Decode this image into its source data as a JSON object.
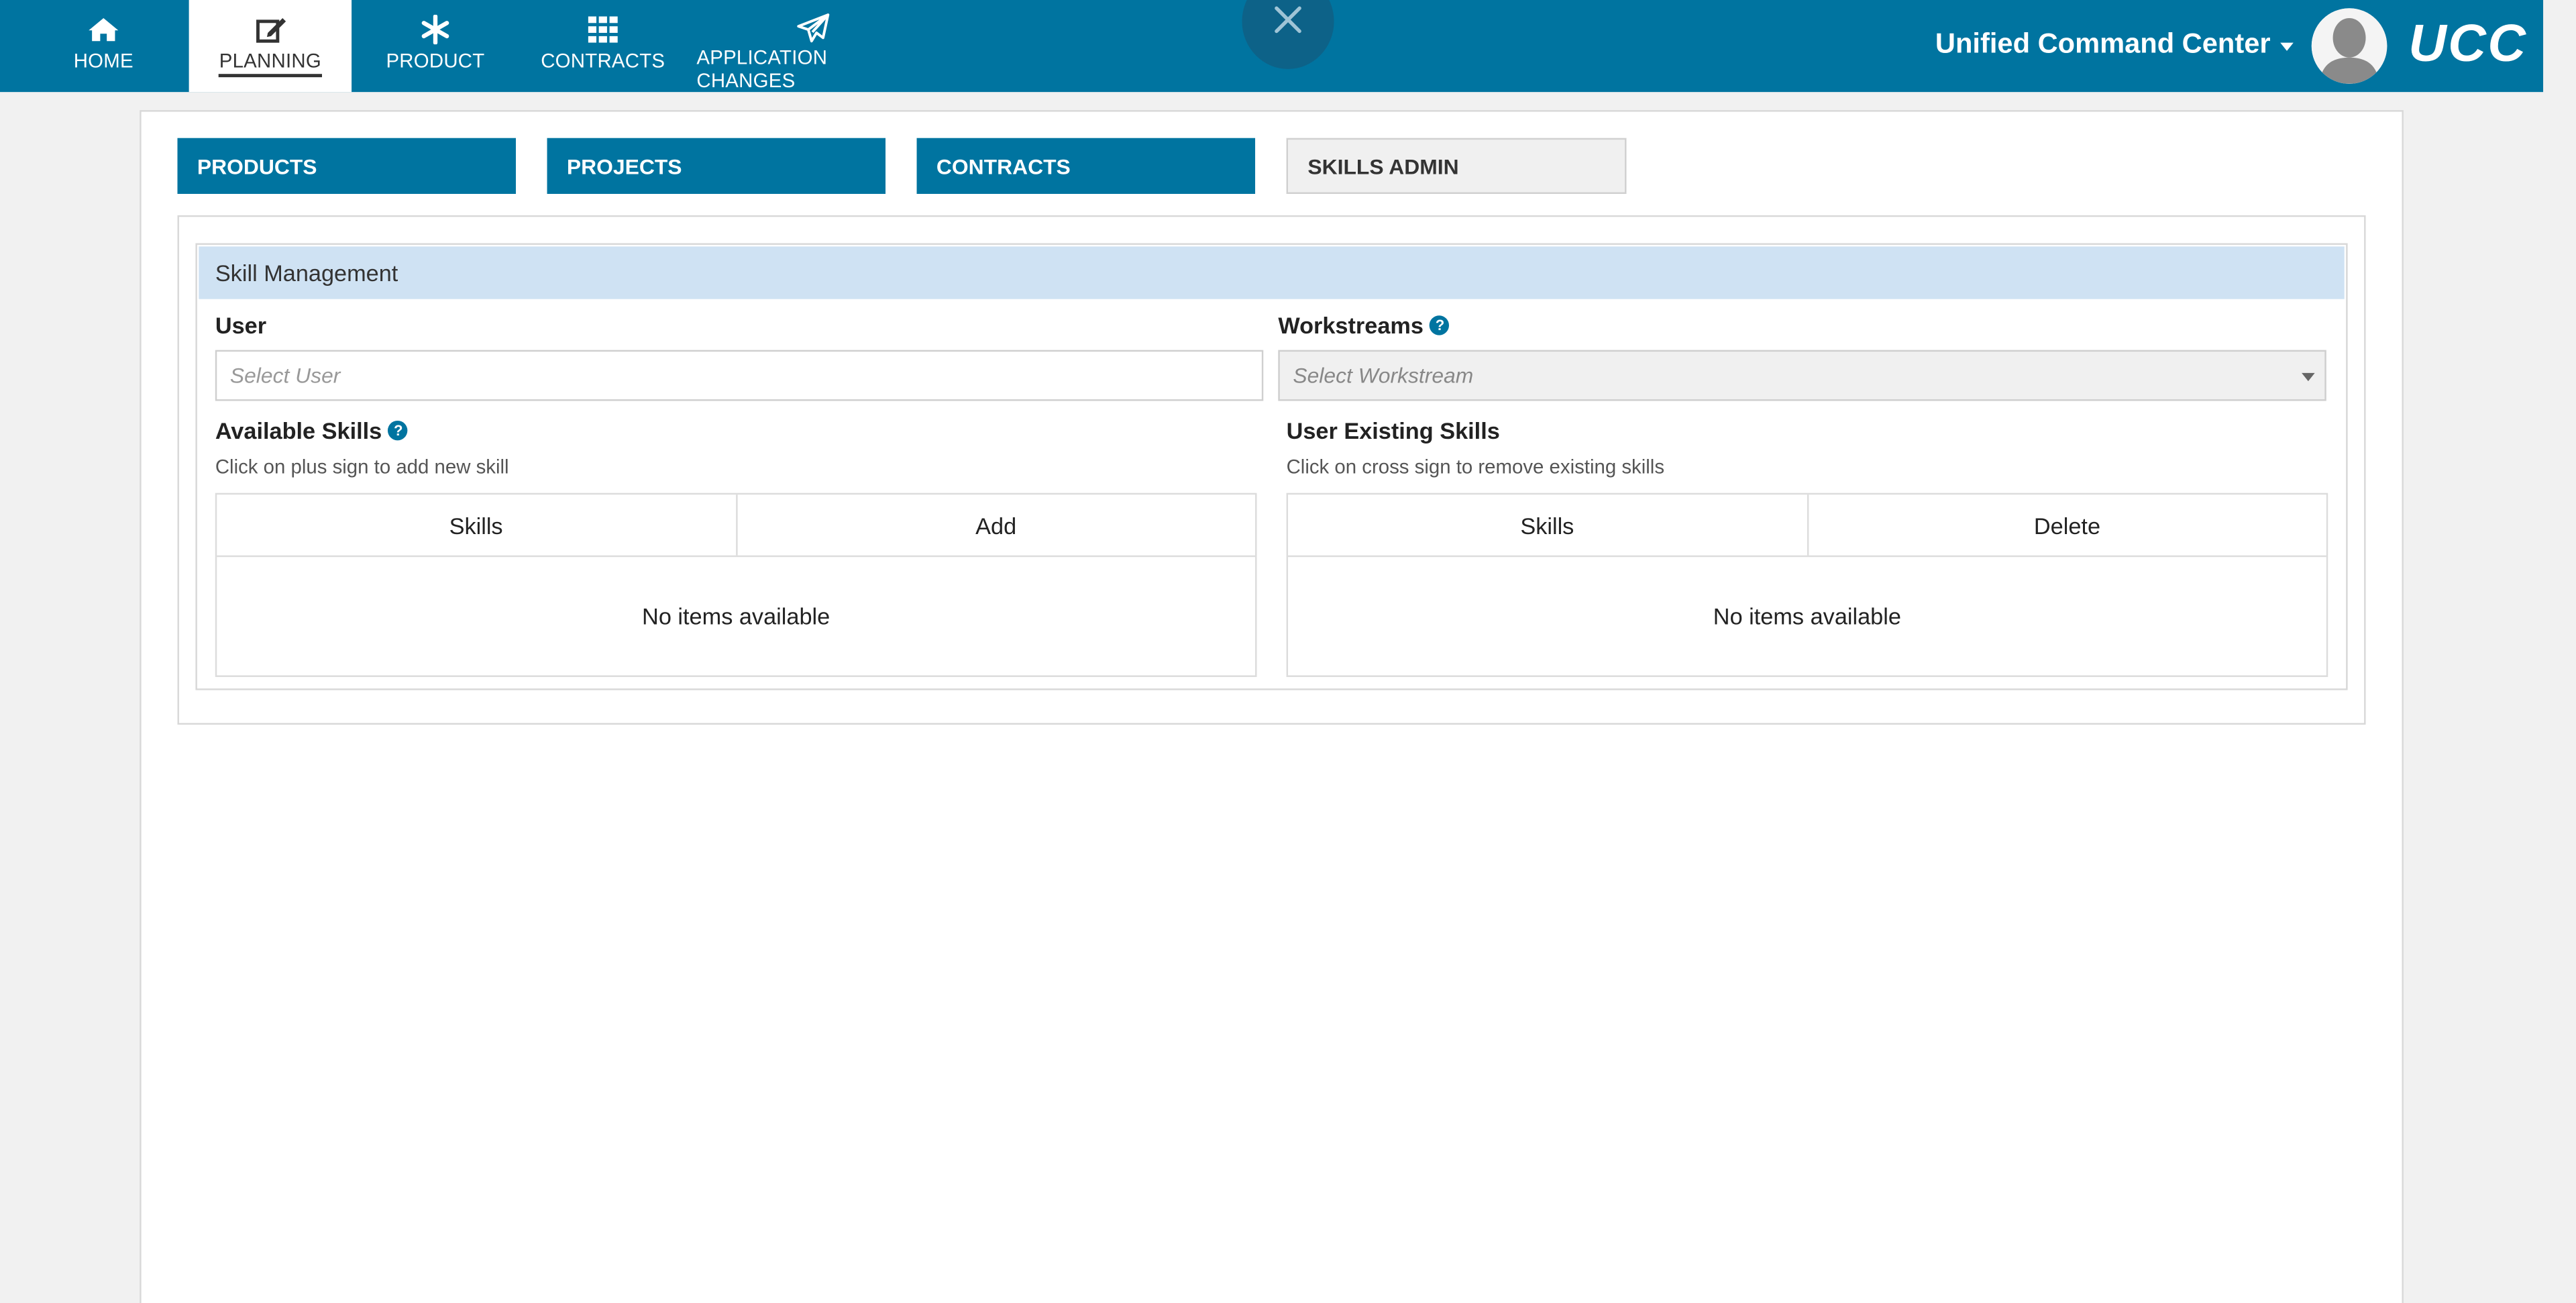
{
  "nav": {
    "items": [
      {
        "label": "HOME",
        "icon": "home-icon"
      },
      {
        "label": "PLANNING",
        "icon": "edit-icon"
      },
      {
        "label": "PRODUCT",
        "icon": "asterisk-icon"
      },
      {
        "label": "CONTRACTS",
        "icon": "grid-icon"
      },
      {
        "label": "APPLICATION CHANGES",
        "icon": "paper-plane-icon"
      }
    ],
    "active": "PLANNING",
    "brand_menu": "Unified Command Center",
    "logo": "UCC"
  },
  "tabs": {
    "products": "PRODUCTS",
    "projects": "PROJECTS",
    "contracts": "CONTRACTS",
    "skills_admin": "SKILLS ADMIN",
    "active": "SKILLS ADMIN"
  },
  "skill_management": {
    "header": "Skill Management",
    "user": {
      "label": "User",
      "placeholder": "Select User"
    },
    "workstreams": {
      "label": "Workstreams",
      "placeholder": "Select Workstream"
    },
    "available": {
      "label": "Available Skills",
      "hint": "Click on plus sign to add new skill",
      "columns": [
        "Skills",
        "Add"
      ],
      "empty": "No items available"
    },
    "existing": {
      "label": "User Existing Skills",
      "hint": "Click on cross sign to remove existing skills",
      "columns": [
        "Skills",
        "Delete"
      ],
      "empty": "No items available"
    }
  },
  "colors": {
    "primary": "#0074a0",
    "header_bg": "#cfe2f3",
    "page_bg": "#f1f1f1"
  }
}
